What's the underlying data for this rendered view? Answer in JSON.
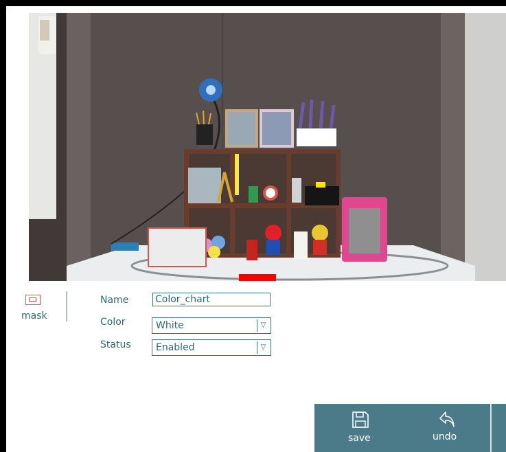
{
  "preview": {
    "image": "camera-preview"
  },
  "mask_tool": {
    "label": "mask",
    "icon": "mask-rect-icon"
  },
  "form": {
    "name": {
      "label": "Name",
      "value": "Color_chart"
    },
    "color": {
      "label": "Color",
      "value": "White"
    },
    "status": {
      "label": "Status",
      "value": "Enabled"
    }
  },
  "toolbar": {
    "save_label": "save",
    "undo_label": "undo",
    "save_icon": "floppy-disk-icon",
    "undo_icon": "undo-arrow-icon"
  },
  "colors": {
    "accent": "#4b7a89",
    "text": "#2e6775",
    "mask": "#d9534f"
  }
}
